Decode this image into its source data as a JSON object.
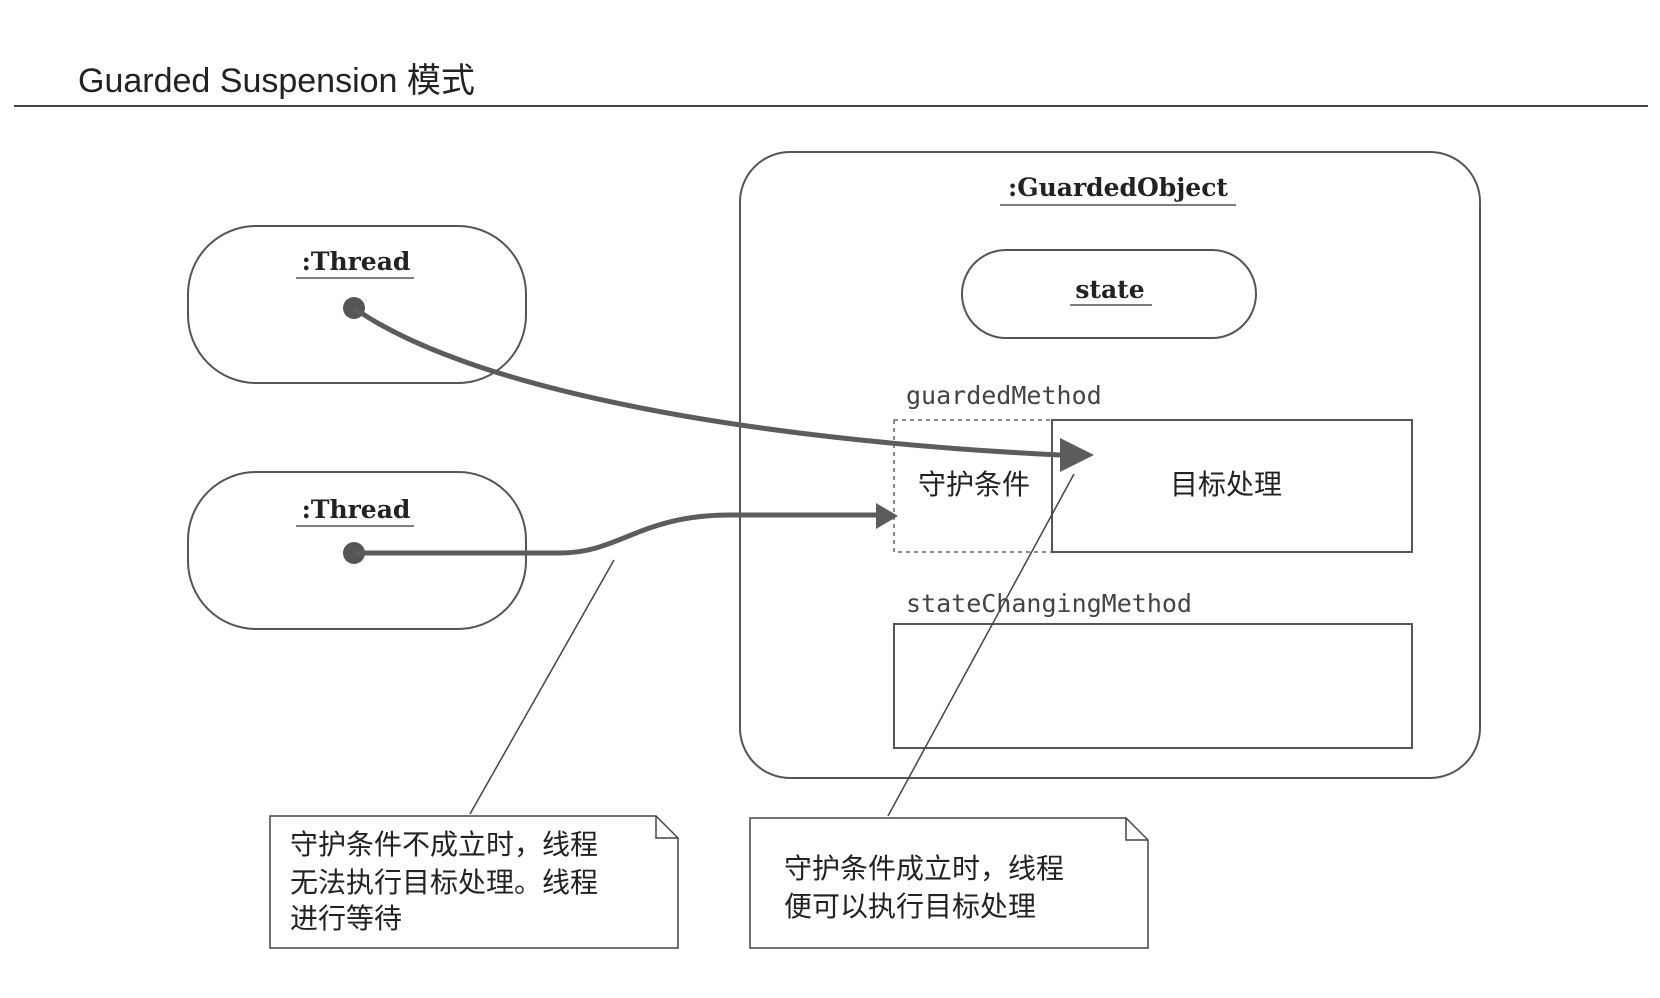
{
  "title": "Guarded Suspension 模式",
  "thread_top": {
    "label": ":Thread"
  },
  "thread_bottom": {
    "label": ":Thread"
  },
  "guarded_object": {
    "label": ":GuardedObject",
    "state_label": "state",
    "guarded_method": {
      "name": "guardedMethod",
      "guard_condition": "守护条件",
      "target_processing": "目标处理"
    },
    "state_changing_method": {
      "name": "stateChangingMethod"
    }
  },
  "note_left": {
    "lines": [
      "守护条件不成立时，线程",
      "无法执行目标处理。线程",
      "进行等待"
    ]
  },
  "note_right": {
    "lines": [
      "守护条件成立时，线程",
      "便可以执行目标处理"
    ]
  },
  "colors": {
    "line": "#444444",
    "arrow": "#5c5c5c",
    "text": "#222222",
    "background": "#ffffff"
  }
}
